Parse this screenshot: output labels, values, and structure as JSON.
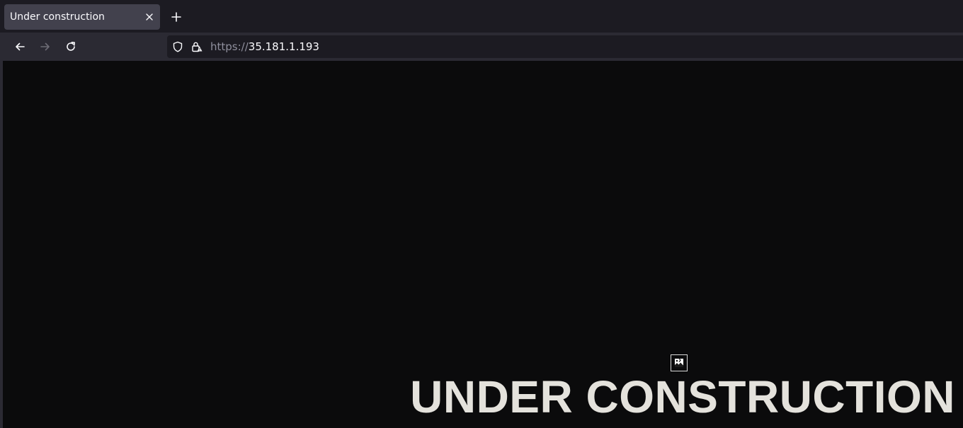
{
  "browser": {
    "tab": {
      "title": "Under construction",
      "close_icon": "close-icon"
    },
    "new_tab_icon": "plus-icon",
    "nav": {
      "back_icon": "back-arrow-icon",
      "forward_icon": "forward-arrow-icon",
      "reload_icon": "reload-icon"
    },
    "urlbar": {
      "shield_icon": "shield-icon",
      "lock_icon": "lock-warning-icon",
      "scheme": "https://",
      "host": "35.181.1.193"
    }
  },
  "page": {
    "background": "#0b0b0c",
    "broken_image_icon": "broken-image-icon",
    "headline": "UNDER CONSTRUCTION",
    "headline_color": "#e4e2dc"
  }
}
